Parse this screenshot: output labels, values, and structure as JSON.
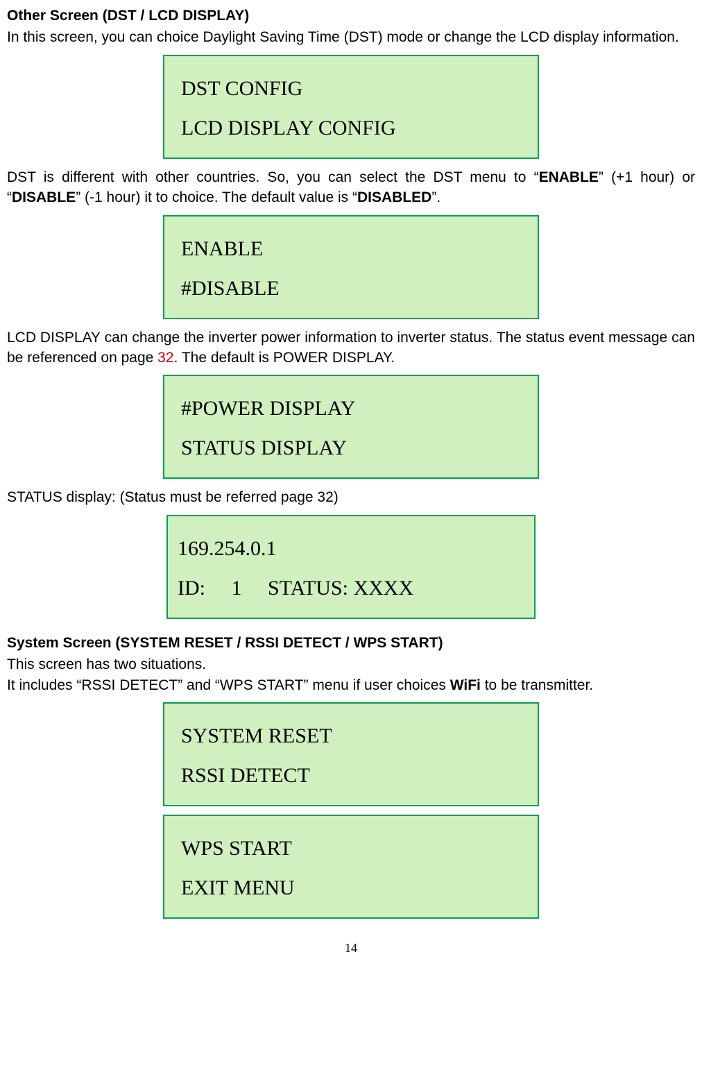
{
  "section1": {
    "heading": "Other Screen (DST / LCD DISPLAY)",
    "para1": "In this screen, you can choice Daylight Saving Time (DST) mode or change the LCD display information."
  },
  "lcd1": {
    "line1": "DST CONFIG",
    "line2": "LCD DISPLAY CONFIG"
  },
  "para2": {
    "t1": "DST is different with other countries. So, you can select the DST menu to “",
    "b1": "ENABLE",
    "t2": "” (+1 hour) or “",
    "b2": "DISABLE",
    "t3": "” (-1 hour) it to choice. The default value is “",
    "b3": "DISABLED",
    "t4": "”."
  },
  "lcd2": {
    "line1": "ENABLE",
    "line2": "#DISABLE"
  },
  "para3": {
    "t1": "LCD DISPLAY can change the inverter power information to inverter status. The status event message can be referenced on page ",
    "r1": "32",
    "t2": ". The default is POWER DISPLAY."
  },
  "lcd3": {
    "line1": "#POWER DISPLAY",
    "line2": "STATUS DISPLAY"
  },
  "para4": "STATUS display: (Status must be referred page 32)",
  "lcd4": {
    "line1": "169.254.0.1",
    "line2": "ID:  1  STATUS: XXXX"
  },
  "section2": {
    "heading": "System Screen (SYSTEM RESET / RSSI DETECT / WPS START)",
    "para1": "This screen has two situations.",
    "para2a": "It includes “RSSI DETECT” and “WPS START” menu if user choices ",
    "para2b": "WiFi",
    "para2c": " to be transmitter."
  },
  "lcd5": {
    "line1": "SYSTEM RESET",
    "line2": "RSSI DETECT"
  },
  "lcd6": {
    "line1": "WPS START",
    "line2": "EXIT MENU"
  },
  "pageNumber": "14"
}
